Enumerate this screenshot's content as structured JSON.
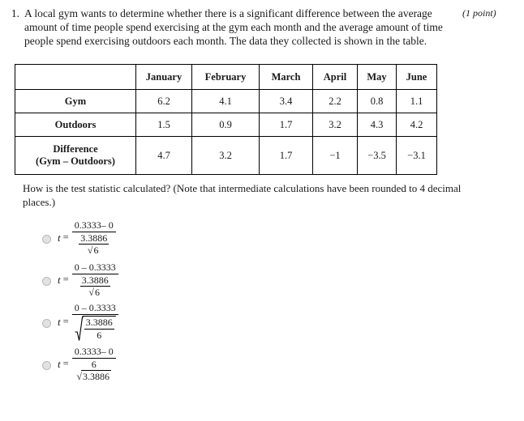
{
  "question": {
    "number": "1.",
    "text": "A local gym wants to determine whether there is a significant difference between the average amount of time people spend exercising at the gym each month and the average amount of time people spend exercising outdoors each month. The data they collected is shown in the table.",
    "points": "(1 point)",
    "subquestion": "How is the test statistic calculated? (Note that intermediate calculations have been rounded to 4 decimal places.)"
  },
  "table": {
    "corner": "",
    "columns": [
      "January",
      "February",
      "March",
      "April",
      "May",
      "June"
    ],
    "rows": [
      {
        "label": "Gym",
        "values": [
          "6.2",
          "4.1",
          "3.4",
          "2.2",
          "0.8",
          "1.1"
        ]
      },
      {
        "label": "Outdoors",
        "values": [
          "1.5",
          "0.9",
          "1.7",
          "3.2",
          "4.3",
          "4.2"
        ]
      },
      {
        "label_line1": "Difference",
        "label_line2": "(Gym – Outdoors)",
        "values": [
          "4.7",
          "3.2",
          "1.7",
          "−1",
          "−3.5",
          "−3.1"
        ]
      }
    ]
  },
  "options": [
    {
      "id": "option-a",
      "var": "t",
      "equals": "=",
      "numerator": "0.3333– 0",
      "denom_type": "fraction",
      "denom_num": "3.3886",
      "denom_den_radicand": "6"
    },
    {
      "id": "option-b",
      "var": "t",
      "equals": "=",
      "numerator": "0 – 0.3333",
      "denom_type": "fraction",
      "denom_num": "3.3886",
      "denom_den_radicand": "6"
    },
    {
      "id": "option-c",
      "var": "t",
      "equals": "=",
      "numerator": "0 – 0.3333",
      "denom_type": "radical-fraction",
      "denom_num": "3.3886",
      "denom_den": "6"
    },
    {
      "id": "option-d",
      "var": "t",
      "equals": "=",
      "numerator": "0.3333– 0",
      "denom_type": "fraction-over-radical",
      "denom_num": "6",
      "denom_den_radicand": "3.3886"
    }
  ]
}
